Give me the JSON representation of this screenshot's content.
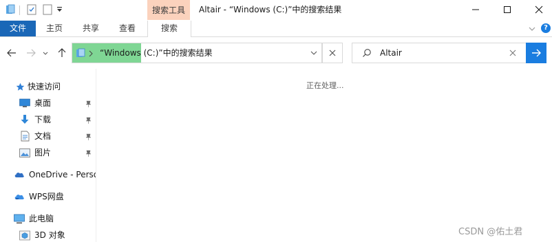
{
  "window": {
    "context_tab_header": "搜索工具",
    "title": "Altair - “Windows (C:)”中的搜索结果"
  },
  "ribbon": {
    "tabs": [
      "文件",
      "主页",
      "共享",
      "查看",
      "搜索"
    ]
  },
  "address": {
    "path": "“Windows (C:)”中的搜索结果"
  },
  "search": {
    "value": "Altair"
  },
  "nav": {
    "quick_access": "快速访问",
    "items": [
      {
        "label": "桌面",
        "icon": "desktop-icon"
      },
      {
        "label": "下载",
        "icon": "download-icon"
      },
      {
        "label": "文档",
        "icon": "document-icon"
      },
      {
        "label": "图片",
        "icon": "pictures-icon"
      }
    ],
    "onedrive": "OneDrive - Perso",
    "wps": "WPS网盘",
    "this_pc": "此电脑",
    "objects_3d": "3D 对象"
  },
  "content": {
    "status": "正在处理..."
  },
  "watermark": "CSDN @佑土君",
  "colors": {
    "file_tab": "#1a67b7",
    "context_tab": "#fbd2bd",
    "address_progress": "#7fd694",
    "search_go": "#1a7de0"
  }
}
